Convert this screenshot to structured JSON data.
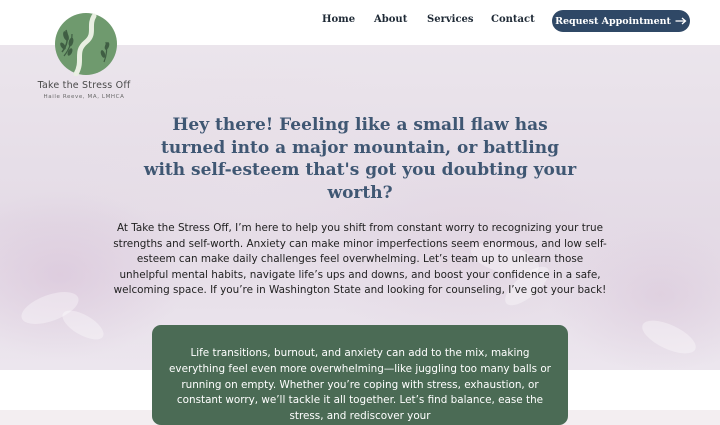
{
  "logo": {
    "name": "Take the Stress Off",
    "subtitle": "Haile Reeve, MA, LMHCA"
  },
  "nav": {
    "items": [
      "Home",
      "About",
      "Services",
      "Contact"
    ],
    "cta_label": "Request Appointment",
    "cta_icon": "arrow-right-icon"
  },
  "hero": {
    "headline": "Hey there! Feeling like a small flaw has turned into a major mountain, or battling with self-esteem that's got you doubting your worth?",
    "intro": "At Take the Stress Off, I’m here to help you shift from constant worry to recognizing your true strengths and self-worth. Anxiety can make minor imperfections seem enormous, and low self-esteem can make daily challenges feel overwhelming. Let’s team up to unlearn those unhelpful mental habits, navigate life’s ups and downs, and boost your confidence in a safe, welcoming space. If you’re in Washington State and looking for counseling, I’ve got your back!"
  },
  "card": {
    "text": "Life transitions, burnout, and anxiety can add to the mix, making everything feel even more overwhelming—like juggling too many balls or running on empty. Whether you’re coping with stress, exhaustion, or constant worry, we’ll tackle it all together. Let’s find balance, ease the stress, and rediscover your"
  },
  "colors": {
    "cta_bg": "#2f4866",
    "headline": "#3f5773",
    "card_bg": "#4b6b55",
    "logo_green": "#6f9a6e"
  }
}
